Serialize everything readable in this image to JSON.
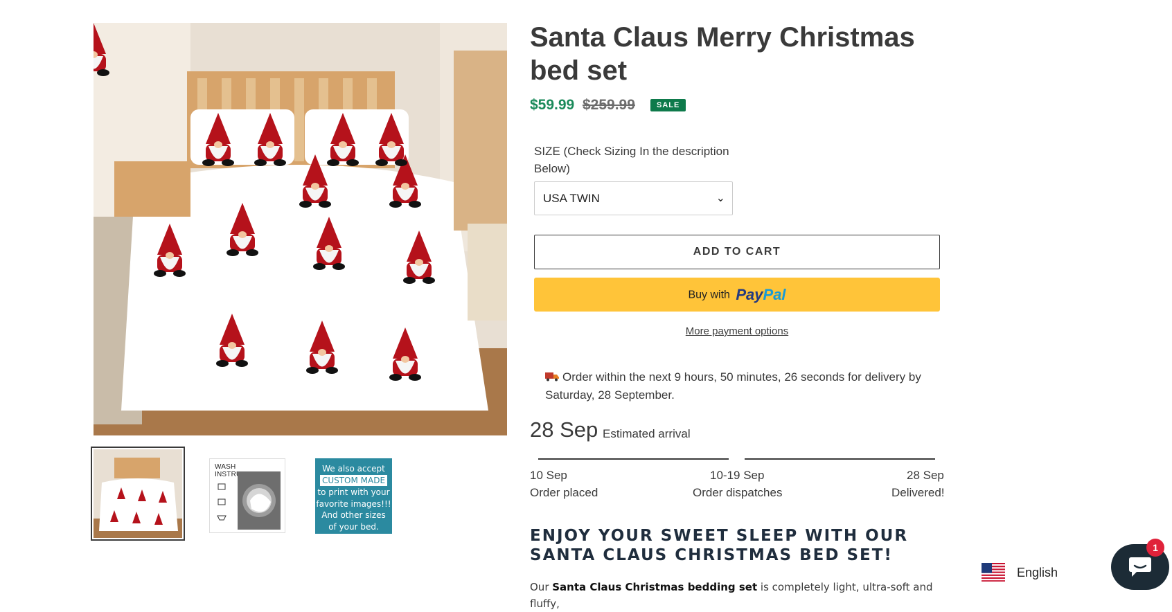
{
  "product": {
    "title": "Santa Claus Merry Christmas bed set",
    "price_sale": "$59.99",
    "price_regular": "$259.99",
    "sale_badge": "SALE"
  },
  "thumbnails": {
    "wash_title": "WASH INSTRUCTIONS",
    "custom_lines": [
      "We also accept",
      "CUSTOM MADE",
      "to print with your",
      "favorite images!!!",
      "And other sizes",
      "of your bed."
    ]
  },
  "size": {
    "label": "SIZE (Check Sizing In the description Below)",
    "selected": "USA TWIN"
  },
  "buttons": {
    "add_to_cart": "ADD TO CART",
    "buy_with": "Buy with",
    "paypal_a": "Pay",
    "paypal_b": "Pal",
    "more_payment": "More payment options"
  },
  "delivery": {
    "message": "Order within the next 9 hours, 50 minutes, 26 seconds for delivery by Saturday, 28 September.",
    "eta_date": "28 Sep",
    "eta_label": "Estimated arrival",
    "steps": [
      {
        "date": "10 Sep",
        "label": "Order placed"
      },
      {
        "date": "10-19 Sep",
        "label": "Order dispatches"
      },
      {
        "date": "28 Sep",
        "label": "Delivered!"
      }
    ]
  },
  "description": {
    "heading": "ENJOY YOUR SWEET SLEEP WITH OUR SANTA CLAUS CHRISTMAS BED SET!",
    "intro_before": "Our ",
    "intro_bold": "Santa Claus Christmas bedding set",
    "intro_after": " is completely light, ultra-soft and fluffy,"
  },
  "language": {
    "label": "English"
  },
  "chat": {
    "badge_count": "1"
  },
  "colors": {
    "sale_price": "#1a8a5a",
    "sale_badge": "#0e7a4b",
    "paypal_yellow": "#ffc439",
    "chat_bg": "#1c2b36",
    "badge_red": "#e0223a"
  }
}
